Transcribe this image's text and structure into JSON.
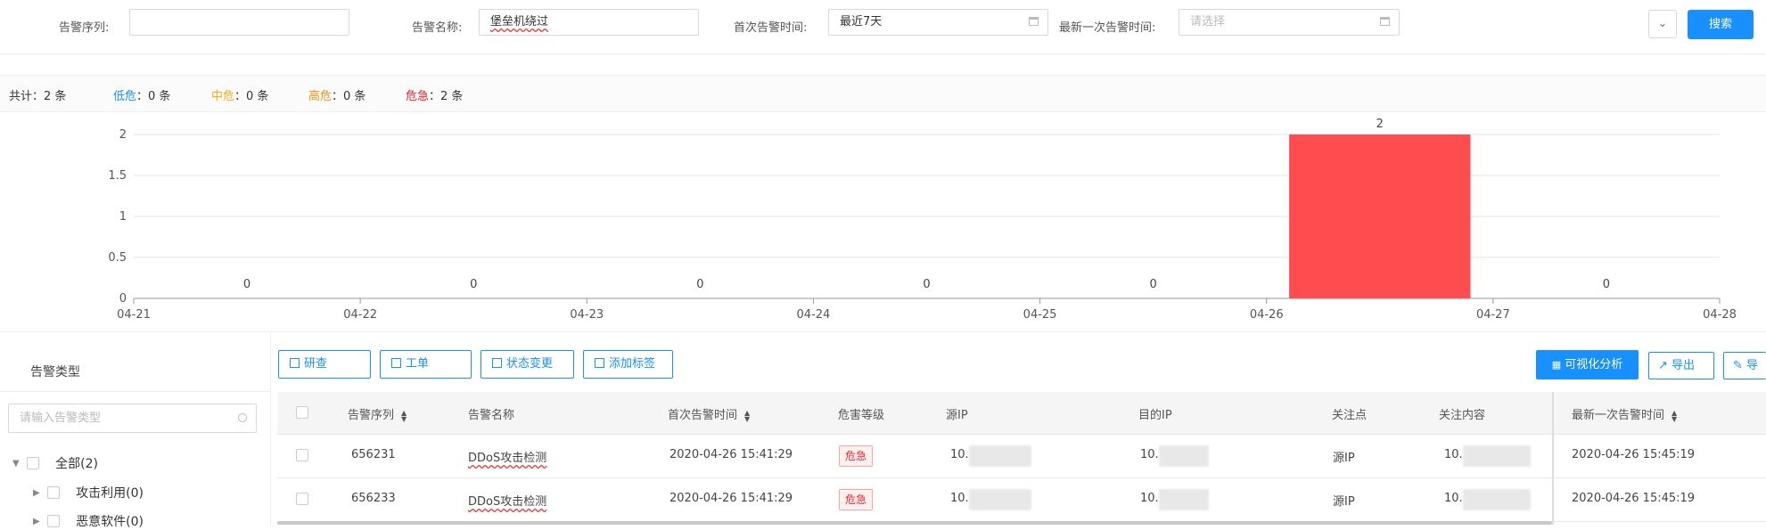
{
  "filters": {
    "alert_seq_label": "告警序列:",
    "alert_seq_value": "",
    "alert_name_label": "告警名称:",
    "alert_name_value": "堡垒机绕过",
    "first_time_label": "首次告警时间:",
    "first_time_value": "最近7天",
    "last_time_label": "最新一次告警时间:",
    "last_time_placeholder": "请选择",
    "search_label": "搜索",
    "expand_icon": "double-chevron-down-icon"
  },
  "stats": {
    "total": "共计：2 条",
    "low_label": "低危",
    "low_value": "：0 条",
    "mid_label": "中危",
    "mid_value": "：0 条",
    "high_label": "高危",
    "high_value": "：0 条",
    "critical_label": "危急",
    "critical_value": "：2 条",
    "colors": {
      "low": "#1890ff",
      "mid": "#faad14",
      "high": "#fa8c16",
      "critical": "#f5222d"
    }
  },
  "chart_data": {
    "type": "bar",
    "categories": [
      "04-21",
      "04-22",
      "04-23",
      "04-24",
      "04-25",
      "04-26",
      "04-27"
    ],
    "x_ticks": [
      "04-21",
      "04-22",
      "04-23",
      "04-24",
      "04-25",
      "04-26",
      "04-27",
      "04-28"
    ],
    "values": [
      0,
      0,
      0,
      0,
      0,
      2,
      0
    ],
    "data_labels": [
      "0",
      "0",
      "0",
      "0",
      "0",
      "2",
      "0"
    ],
    "y_ticks": [
      "0",
      "0.5",
      "1",
      "1.5",
      "2"
    ],
    "ylim": [
      0,
      2
    ],
    "grid": true,
    "bar_color": "#ff4d4f"
  },
  "left_panel": {
    "title": "告警类型",
    "search_placeholder": "请输入告警类型",
    "tree": [
      {
        "label": "全部(2)",
        "expanded": true
      },
      {
        "label": "攻击利用(0)",
        "expanded": false
      },
      {
        "label": "恶意软件(0)",
        "expanded": false
      }
    ]
  },
  "toolbar": {
    "review": "研查",
    "ticket": "工单",
    "status_change": "状态变更",
    "add_tag": "添加标签",
    "visual_analysis": "可视化分析",
    "export": "导出",
    "export2": "导"
  },
  "table": {
    "headers": {
      "seq": "告警序列",
      "name": "告警名称",
      "first_time": "首次告警时间",
      "level": "危害等级",
      "src_ip": "源IP",
      "dst_ip": "目的IP",
      "focus": "关注点",
      "focus_content": "关注内容",
      "last_time": "最新一次告警时间"
    },
    "rows": [
      {
        "seq": "656231",
        "name": "DDoS攻击检测",
        "first_time": "2020-04-26 15:41:29",
        "level": "危急",
        "src_ip": "10.",
        "dst_ip": "10.",
        "focus": "源IP",
        "focus_content": "10.",
        "last_time": "2020-04-26 15:45:19"
      },
      {
        "seq": "656233",
        "name": "DDoS攻击检测",
        "first_time": "2020-04-26 15:41:29",
        "level": "危急",
        "src_ip": "10.",
        "dst_ip": "10.",
        "focus": "源IP",
        "focus_content": "10.",
        "last_time": "2020-04-26 15:45:19"
      }
    ]
  }
}
